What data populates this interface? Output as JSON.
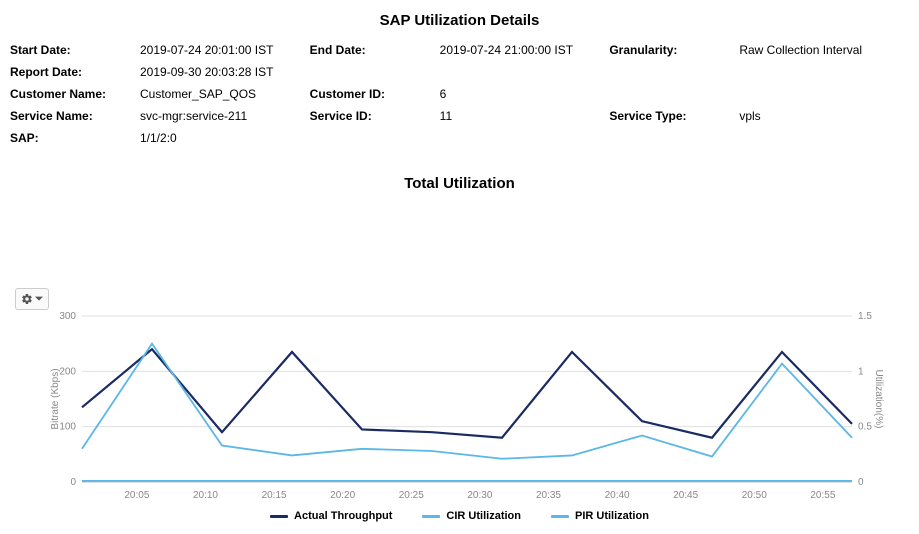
{
  "page_title": "SAP Utilization Details",
  "meta": {
    "start_label": "Start Date:",
    "start_value": "2019-07-24 20:01:00 IST",
    "end_label": "End Date:",
    "end_value": "2019-07-24 21:00:00 IST",
    "granularity_label": "Granularity:",
    "granularity_value": "Raw Collection Interval",
    "report_label": "Report Date:",
    "report_value": "2019-09-30 20:03:28 IST",
    "customer_name_label": "Customer Name:",
    "customer_name_value": "Customer_SAP_QOS",
    "customer_id_label": "Customer ID:",
    "customer_id_value": "6",
    "service_name_label": "Service Name:",
    "service_name_value": "svc-mgr:service-211",
    "service_id_label": "Service ID:",
    "service_id_value": "11",
    "service_type_label": "Service Type:",
    "service_type_value": "vpls",
    "sap_label": "SAP:",
    "sap_value": "1/1/2:0"
  },
  "chart_title": "Total Utilization",
  "chart_data": {
    "type": "line",
    "xlabel": "",
    "ylabel_left": "Bitrate (Kbps)",
    "ylabel_right": "Utilization(%)",
    "ylim_left": [
      0,
      300
    ],
    "ylim_right": [
      0,
      1.5
    ],
    "yticks_left": [
      0,
      100,
      200,
      300
    ],
    "yticks_right": [
      0,
      0.5,
      1,
      1.5
    ],
    "x_tick_labels": [
      "20:05",
      "20:10",
      "20:15",
      "20:20",
      "20:25",
      "20:30",
      "20:35",
      "20:40",
      "20:45",
      "20:50",
      "20:55"
    ],
    "series": [
      {
        "name": "Actual Throughput",
        "axis": "left",
        "color": "#1a2a63",
        "values": [
          135,
          240,
          90,
          235,
          95,
          90,
          80,
          235,
          110,
          80,
          235,
          105
        ]
      },
      {
        "name": "CIR Utilization",
        "axis": "right",
        "color": "#5ab7e6",
        "values": [
          0.3,
          1.25,
          0.33,
          0.24,
          0.3,
          0.28,
          0.21,
          0.24,
          0.42,
          0.23,
          1.07,
          0.4
        ]
      },
      {
        "name": "PIR Utilization",
        "axis": "right",
        "color": "#5ab7e6",
        "values": [
          0.01,
          0.01,
          0.01,
          0.01,
          0.01,
          0.01,
          0.01,
          0.01,
          0.01,
          0.01,
          0.01,
          0.01
        ]
      }
    ]
  },
  "legend_labels": {
    "actual": "Actual Throughput",
    "cir": "CIR Utilization",
    "pir": "PIR Utilization"
  }
}
